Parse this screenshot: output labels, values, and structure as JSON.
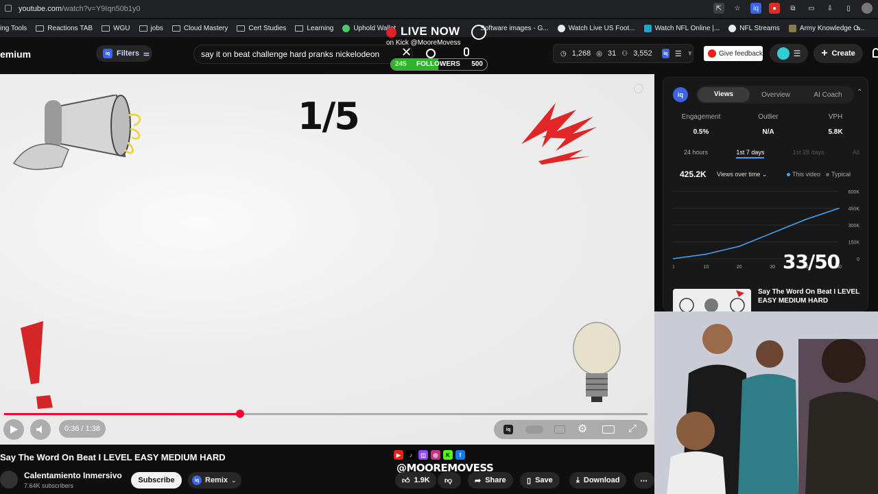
{
  "browser": {
    "url_host": "youtube.com",
    "url_path": "/watch?v=Y9Iqn50b1y0"
  },
  "bookmarks": [
    {
      "label": "ing Tools",
      "icon": "folder-icon"
    },
    {
      "label": "Reactions TAB",
      "icon": "folder-icon"
    },
    {
      "label": "WGU",
      "icon": "folder-icon"
    },
    {
      "label": "jobs",
      "icon": "folder-icon"
    },
    {
      "label": "Cloud Mastery",
      "icon": "folder-icon"
    },
    {
      "label": "Cert Studies",
      "icon": "folder-icon"
    },
    {
      "label": "Learning",
      "icon": "folder-icon"
    },
    {
      "label": "Uphold Wallet",
      "icon": "uphold-icon"
    },
    {
      "label": "Software images - G...",
      "icon": "globe-icon"
    },
    {
      "label": "Watch Live US Foot...",
      "icon": "globe-icon"
    },
    {
      "label": "Watch NFL Online |...",
      "icon": "globe-icon"
    },
    {
      "label": "NFL Streams",
      "icon": "globe-icon"
    },
    {
      "label": "Army Knowledge O...",
      "icon": "ako-icon"
    }
  ],
  "header": {
    "logo_text": "emium",
    "filters_label": "Filters",
    "search_value": "say it on beat challenge hard pranks nickelodeon",
    "stats": {
      "views": "1,268",
      "eye": "31",
      "subs": "3,552"
    },
    "feedback_label": "Give feedback",
    "create_label": "Create"
  },
  "overlay": {
    "live_now": "LIVE NOW",
    "on_kick": "on Kick @MooreMovess",
    "followers_current": "245",
    "followers_label": "FOLLOWERS",
    "followers_goal": "500",
    "followers_progress": 0.49,
    "handle": "@MOOREMOVESS",
    "socials": [
      "youtube",
      "tiktok",
      "twitch",
      "instagram",
      "kick",
      "facebook"
    ]
  },
  "video": {
    "counter": "1/5",
    "time": "0:36 / 1:38",
    "progress": 0.367,
    "title": "Say The Word On Beat I LEVEL EASY MEDIUM HARD",
    "channel": "Calentamiento Inmersivo",
    "subscribers": "7.64K subscribers",
    "subscribe_label": "Subscribe",
    "remix_label": "Remix",
    "likes": "1.9K",
    "share_label": "Share",
    "save_label": "Save",
    "download_label": "Download"
  },
  "iq_panel": {
    "tabs": [
      "Views",
      "Overview",
      "AI Coach"
    ],
    "active_tab": "Views",
    "metrics": [
      {
        "label": "Engagement",
        "value": "0.5%"
      },
      {
        "label": "Outlier",
        "value": "N/A"
      },
      {
        "label": "VPH",
        "value": "5.8K"
      }
    ],
    "periods": [
      "24 hours",
      "1st 7 days",
      "1st 28 days",
      "All"
    ],
    "active_period": "1st 7 days",
    "total_views": "425.2K",
    "chart_select": "Views over time",
    "legend": [
      "This video",
      "Typical"
    ],
    "position": "33/50",
    "related_title": "Say The Word On Beat I LEVEL EASY MEDIUM HARD",
    "colors": {
      "accent": "#3ea6ff",
      "iq": "#3d64e6"
    }
  },
  "chart_data": {
    "type": "line",
    "x": [
      0,
      10,
      20,
      30,
      40,
      50
    ],
    "x_ticks": [
      "0",
      "10",
      "20",
      "30",
      "40",
      "50"
    ],
    "y_ticks": [
      "0",
      "150K",
      "300K",
      "450K",
      "600K"
    ],
    "ylim": [
      0,
      600000
    ],
    "series": [
      {
        "name": "This video",
        "values": [
          0,
          40000,
          110000,
          230000,
          350000,
          450000
        ]
      }
    ]
  }
}
